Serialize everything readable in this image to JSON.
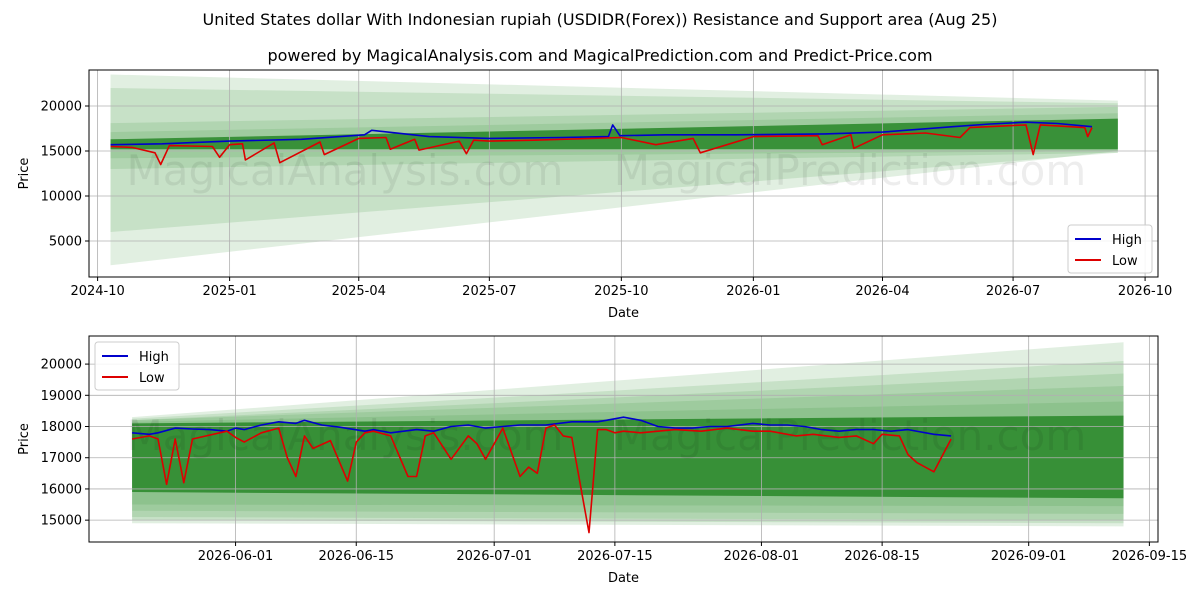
{
  "title": "United States dollar With Indonesian rupiah (USDIDR(Forex)) Resistance and Support area (Aug 25)",
  "subtitle": "powered by MagicalAnalysis.com and MagicalPrediction.com and Predict-Price.com",
  "watermark_left": "MagicalAnalysis.com",
  "watermark_right": "MagicalPrediction.com",
  "colors": {
    "high": "#0000cc",
    "low": "#dd0000",
    "band": "#2e8b2e",
    "grid": "#b0b0b0"
  },
  "chart_data": [
    {
      "type": "line",
      "xlabel": "Date",
      "ylabel": "Price",
      "xlim": [
        "2024-09-25",
        "2026-10-10"
      ],
      "ylim": [
        1000,
        24000
      ],
      "grid": true,
      "legend": {
        "placement": "lower-right",
        "entries": [
          "High",
          "Low"
        ]
      },
      "x_ticks": [
        "2024-10",
        "2025-01",
        "2025-04",
        "2025-07",
        "2025-10",
        "2026-01",
        "2026-04",
        "2026-07",
        "2026-10"
      ],
      "y_ticks": [
        5000,
        10000,
        15000,
        20000
      ],
      "bands": {
        "start": "2024-10-10",
        "end": "2026-09-12",
        "inner": [
          [
            15200,
            16300,
            15200,
            18600
          ]
        ],
        "fan": [
          [
            14200,
            17100,
            15000,
            19200
          ],
          [
            13000,
            18100,
            14800,
            19900
          ],
          [
            6000,
            22000,
            14800,
            20300
          ],
          [
            2300,
            23500,
            15000,
            20600
          ]
        ]
      },
      "series": [
        {
          "name": "High",
          "x": [
            "2024-10-10",
            "2024-11-15",
            "2025-01-01",
            "2025-02-20",
            "2025-04-05",
            "2025-04-10",
            "2025-05-20",
            "2025-07-01",
            "2025-08-20",
            "2025-09-22",
            "2025-09-25",
            "2025-09-30",
            "2025-11-01",
            "2025-12-20",
            "2026-02-20",
            "2026-04-01",
            "2026-05-20",
            "2026-06-15",
            "2026-07-10",
            "2026-08-01",
            "2026-08-25"
          ],
          "values": [
            15700,
            15800,
            16100,
            16300,
            16800,
            17300,
            16600,
            16400,
            16500,
            16600,
            17900,
            16700,
            16800,
            16800,
            16900,
            17100,
            17700,
            18000,
            18200,
            18050,
            17700
          ]
        },
        {
          "name": "Low",
          "x": [
            "2024-10-10",
            "2024-10-25",
            "2024-11-10",
            "2024-11-14",
            "2024-11-20",
            "2024-12-20",
            "2024-12-25",
            "2025-01-01",
            "2025-01-10",
            "2025-01-12",
            "2025-02-01",
            "2025-02-05",
            "2025-03-05",
            "2025-03-08",
            "2025-04-01",
            "2025-04-20",
            "2025-04-23",
            "2025-05-10",
            "2025-05-13",
            "2025-06-10",
            "2025-06-15",
            "2025-06-20",
            "2025-07-01",
            "2025-08-01",
            "2025-10-01",
            "2025-10-25",
            "2025-11-20",
            "2025-11-25",
            "2026-01-01",
            "2026-02-15",
            "2026-02-18",
            "2026-03-10",
            "2026-03-12",
            "2026-04-01",
            "2026-05-01",
            "2026-05-25",
            "2026-06-01",
            "2026-07-10",
            "2026-07-15",
            "2026-07-20",
            "2026-08-20",
            "2026-08-22",
            "2026-08-25"
          ],
          "values": [
            15500,
            15400,
            14800,
            13500,
            15600,
            15500,
            14300,
            15700,
            15800,
            14000,
            15900,
            13700,
            16000,
            14600,
            16400,
            16500,
            15200,
            16300,
            15100,
            16100,
            14700,
            16200,
            16100,
            16200,
            16500,
            15700,
            16400,
            14800,
            16600,
            16700,
            15700,
            16800,
            15300,
            16800,
            17000,
            16500,
            17600,
            17900,
            14600,
            17900,
            17600,
            16600,
            17600
          ]
        }
      ]
    },
    {
      "type": "line",
      "xlabel": "Date",
      "ylabel": "Price",
      "xlim": [
        "2026-05-15",
        "2026-09-16"
      ],
      "ylim": [
        14300,
        20900
      ],
      "grid": true,
      "legend": {
        "placement": "upper-left",
        "entries": [
          "High",
          "Low"
        ]
      },
      "x_ticks": [
        "2026-06-01",
        "2026-06-15",
        "2026-07-01",
        "2026-07-15",
        "2026-08-01",
        "2026-08-15",
        "2026-09-01",
        "2026-09-15"
      ],
      "y_ticks": [
        15000,
        16000,
        17000,
        18000,
        19000,
        20000
      ],
      "bands": {
        "start": "2026-05-20",
        "end": "2026-09-12",
        "inner": [
          [
            15900,
            18100,
            15700,
            18350
          ]
        ],
        "fan": [
          [
            15500,
            18150,
            15450,
            18800
          ],
          [
            15300,
            18200,
            15200,
            19300
          ],
          [
            15100,
            18200,
            15000,
            19700
          ],
          [
            15000,
            18250,
            14900,
            20100
          ],
          [
            14900,
            18300,
            14800,
            20700
          ]
        ]
      },
      "series": [
        {
          "name": "High",
          "x": [
            "2026-05-20",
            "2026-05-22",
            "2026-05-23",
            "2026-05-25",
            "2026-05-27",
            "2026-05-29",
            "2026-05-31",
            "2026-06-01",
            "2026-06-02",
            "2026-06-04",
            "2026-06-06",
            "2026-06-08",
            "2026-06-09",
            "2026-06-11",
            "2026-06-13",
            "2026-06-16",
            "2026-06-17",
            "2026-06-19",
            "2026-06-22",
            "2026-06-24",
            "2026-06-26",
            "2026-06-28",
            "2026-06-30",
            "2026-07-02",
            "2026-07-04",
            "2026-07-07",
            "2026-07-10",
            "2026-07-13",
            "2026-07-14",
            "2026-07-16",
            "2026-07-18",
            "2026-07-20",
            "2026-07-22",
            "2026-07-24",
            "2026-07-26",
            "2026-07-28",
            "2026-07-31",
            "2026-08-02",
            "2026-08-04",
            "2026-08-06",
            "2026-08-08",
            "2026-08-10",
            "2026-08-12",
            "2026-08-14",
            "2026-08-16",
            "2026-08-18",
            "2026-08-21",
            "2026-08-23"
          ],
          "values": [
            17800,
            17750,
            17800,
            17950,
            17920,
            17900,
            17850,
            17950,
            17900,
            18050,
            18150,
            18100,
            18200,
            18050,
            17980,
            17850,
            17900,
            17800,
            17900,
            17850,
            18000,
            18050,
            17950,
            18000,
            18050,
            18050,
            18150,
            18150,
            18200,
            18300,
            18200,
            18000,
            17950,
            17950,
            18000,
            18000,
            18100,
            18050,
            18050,
            18000,
            17900,
            17850,
            17900,
            17900,
            17850,
            17900,
            17750,
            17700
          ]
        },
        {
          "name": "Low",
          "x": [
            "2026-05-20",
            "2026-05-22",
            "2026-05-23",
            "2026-05-24",
            "2026-05-25",
            "2026-05-26",
            "2026-05-27",
            "2026-05-31",
            "2026-06-01",
            "2026-06-02",
            "2026-06-04",
            "2026-06-06",
            "2026-06-07",
            "2026-06-08",
            "2026-06-09",
            "2026-06-10",
            "2026-06-12",
            "2026-06-14",
            "2026-06-15",
            "2026-06-16",
            "2026-06-17",
            "2026-06-19",
            "2026-06-21",
            "2026-06-22",
            "2026-06-23",
            "2026-06-24",
            "2026-06-26",
            "2026-06-28",
            "2026-06-29",
            "2026-06-30",
            "2026-07-02",
            "2026-07-04",
            "2026-07-05",
            "2026-07-06",
            "2026-07-07",
            "2026-07-08",
            "2026-07-09",
            "2026-07-10",
            "2026-07-12",
            "2026-07-13",
            "2026-07-14",
            "2026-07-15",
            "2026-07-16",
            "2026-07-18",
            "2026-07-20",
            "2026-07-22",
            "2026-07-25",
            "2026-07-28",
            "2026-07-31",
            "2026-08-02",
            "2026-08-05",
            "2026-08-07",
            "2026-08-10",
            "2026-08-12",
            "2026-08-14",
            "2026-08-15",
            "2026-08-17",
            "2026-08-18",
            "2026-08-19",
            "2026-08-21",
            "2026-08-23"
          ],
          "values": [
            17600,
            17700,
            17600,
            16150,
            17600,
            16200,
            17600,
            17850,
            17650,
            17500,
            17800,
            17950,
            17000,
            16400,
            17700,
            17300,
            17550,
            16250,
            17500,
            17800,
            17850,
            17700,
            16400,
            16400,
            17700,
            17800,
            16950,
            17700,
            17450,
            16950,
            17950,
            16400,
            16700,
            16500,
            17950,
            18050,
            17700,
            17650,
            14600,
            17900,
            17900,
            17800,
            17850,
            17800,
            17850,
            17900,
            17850,
            17950,
            17850,
            17850,
            17700,
            17750,
            17650,
            17700,
            17450,
            17750,
            17700,
            17100,
            16850,
            16550,
            17600
          ]
        }
      ]
    }
  ]
}
